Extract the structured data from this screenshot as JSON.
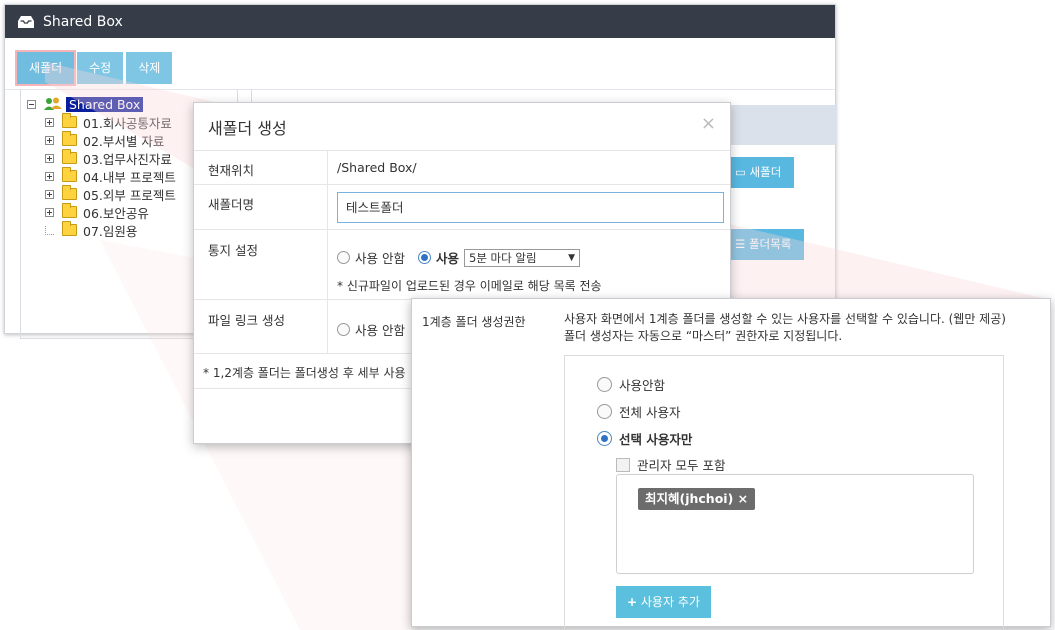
{
  "app": {
    "title": "Shared Box",
    "toolbar": {
      "new_folder": "새폴더",
      "edit": "수정",
      "delete": "삭제"
    }
  },
  "tree": {
    "root": "Shared Box",
    "items": [
      {
        "label": "01.회사공통자료"
      },
      {
        "label": "02.부서별 자료"
      },
      {
        "label": "03.업무사진자료"
      },
      {
        "label": "04.내부 프로젝트"
      },
      {
        "label": "05.외부 프로젝트"
      },
      {
        "label": "06.보안공유"
      },
      {
        "label": "07.임원용"
      }
    ]
  },
  "side_buttons": {
    "new_folder": "새폴더",
    "folder_list": "폴더목록"
  },
  "dialog": {
    "title": "새폴더 생성",
    "close": "×",
    "location_label": "현재위치",
    "location_value": "/Shared Box/",
    "name_label": "새폴더명",
    "name_value": "테스트폴더",
    "notify_label": "통지 설정",
    "notify_off": "사용 안함",
    "notify_on": "사용",
    "notify_interval": "5분 마다 알림",
    "notify_note": "* 신규파일이 업로드된 경우 이메일로 해당 목록 전송",
    "filelink_label": "파일 링크 생성",
    "filelink_off": "사용 안함",
    "footnote": "* 1,2계층 폴더는 폴더생성 후 세부 사용"
  },
  "panel": {
    "label": "1계층 폴더 생성권한",
    "desc_line1": "사용자 화면에서 1계층 폴더를 생성할 수 있는 사용자를 선택할 수 있습니다. (웹만 제공)",
    "desc_line2": "폴더 생성자는 자동으로 “마스터” 권한자로 지정됩니다.",
    "options": [
      "사용안함",
      "전체 사용자",
      "선택 사용자만"
    ],
    "include_admins": "관리자 모두 포함",
    "selected_user": "최지혜(jhchoi)",
    "chip_remove": "×",
    "add_user": "사용자 추가"
  },
  "colors": {
    "titlebar": "#363d48",
    "button": "#7fc6e4",
    "accent": "#5bc0de"
  }
}
